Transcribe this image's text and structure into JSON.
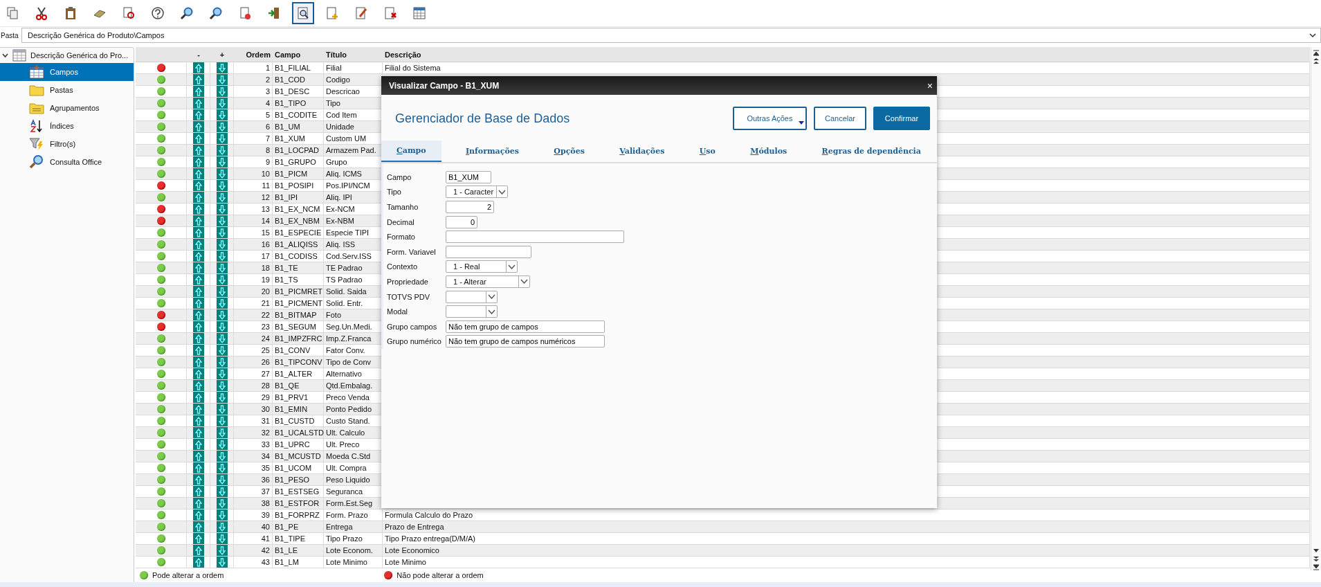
{
  "toolbar": [
    {
      "selected": false
    },
    {
      "selected": false
    },
    {
      "selected": false
    },
    {
      "selected": false
    },
    {
      "selected": false
    },
    {
      "selected": false
    },
    {
      "selected": false
    },
    {
      "selected": false
    },
    {
      "selected": false
    },
    {
      "selected": false
    },
    {
      "selected": true
    },
    {
      "selected": false
    },
    {
      "selected": false
    },
    {
      "selected": false
    },
    {
      "selected": false
    }
  ],
  "folder": {
    "label": "Pasta",
    "value": "Descrição Genérica do Produto\\Campos"
  },
  "sidebar": {
    "root": {
      "label": "Descrição Genérica do Pro...",
      "expanded": true
    },
    "items": [
      {
        "label": "Campos",
        "selected": true
      },
      {
        "label": "Pastas",
        "selected": false
      },
      {
        "label": "Agrupamentos",
        "selected": false
      },
      {
        "label": "Índices",
        "selected": false
      },
      {
        "label": "Filtro(s)",
        "selected": false
      },
      {
        "label": "Consulta Office",
        "selected": false
      }
    ]
  },
  "table": {
    "columns": [
      "-",
      "+",
      "Ordem",
      "Campo",
      "Título",
      "Descrição"
    ],
    "rows": [
      {
        "order": "1",
        "field": "B1_FILIAL",
        "title": "Filial",
        "description": "Filial do Sistema",
        "locked": true
      },
      {
        "order": "2",
        "field": "B1_COD",
        "title": "Codigo",
        "locked": false
      },
      {
        "order": "3",
        "field": "B1_DESC",
        "title": "Descricao",
        "locked": false
      },
      {
        "order": "4",
        "field": "B1_TIPO",
        "title": "Tipo",
        "locked": false
      },
      {
        "order": "5",
        "field": "B1_CODITE",
        "title": "Cod Item",
        "locked": false
      },
      {
        "order": "6",
        "field": "B1_UM",
        "title": "Unidade",
        "locked": false
      },
      {
        "order": "7",
        "field": "B1_XUM",
        "title": "Custom UM",
        "locked": false
      },
      {
        "order": "8",
        "field": "B1_LOCPAD",
        "title": "Armazem Pad.",
        "locked": false
      },
      {
        "order": "9",
        "field": "B1_GRUPO",
        "title": "Grupo",
        "locked": false
      },
      {
        "order": "10",
        "field": "B1_PICM",
        "title": "Aliq. ICMS",
        "locked": false
      },
      {
        "order": "11",
        "field": "B1_POSIPI",
        "title": "Pos.IPI/NCM",
        "locked": true
      },
      {
        "order": "12",
        "field": "B1_IPI",
        "title": "Aliq. IPI",
        "locked": false
      },
      {
        "order": "13",
        "field": "B1_EX_NCM",
        "title": "Ex-NCM",
        "locked": true
      },
      {
        "order": "14",
        "field": "B1_EX_NBM",
        "title": "Ex-NBM",
        "locked": true
      },
      {
        "order": "15",
        "field": "B1_ESPECIE",
        "title": "Especie TIPI",
        "locked": false
      },
      {
        "order": "16",
        "field": "B1_ALIQISS",
        "title": "Aliq. ISS",
        "locked": false
      },
      {
        "order": "17",
        "field": "B1_CODISS",
        "title": "Cod.Serv.ISS",
        "locked": false
      },
      {
        "order": "18",
        "field": "B1_TE",
        "title": "TE Padrao",
        "locked": false
      },
      {
        "order": "19",
        "field": "B1_TS",
        "title": "TS Padrao",
        "locked": false
      },
      {
        "order": "20",
        "field": "B1_PICMRET",
        "title": "Solid. Saida",
        "locked": false
      },
      {
        "order": "21",
        "field": "B1_PICMENT",
        "title": "Solid. Entr.",
        "locked": false
      },
      {
        "order": "22",
        "field": "B1_BITMAP",
        "title": "Foto",
        "locked": true
      },
      {
        "order": "23",
        "field": "B1_SEGUM",
        "title": "Seg.Un.Medi.",
        "locked": true
      },
      {
        "order": "24",
        "field": "B1_IMPZFRC",
        "title": "Imp.Z.Franca",
        "locked": false
      },
      {
        "order": "25",
        "field": "B1_CONV",
        "title": "Fator Conv.",
        "locked": false
      },
      {
        "order": "26",
        "field": "B1_TIPCONV",
        "title": "Tipo de Conv",
        "locked": false
      },
      {
        "order": "27",
        "field": "B1_ALTER",
        "title": "Alternativo",
        "locked": false
      },
      {
        "order": "28",
        "field": "B1_QE",
        "title": "Qtd.Embalag.",
        "locked": false
      },
      {
        "order": "29",
        "field": "B1_PRV1",
        "title": "Preco Venda",
        "locked": false
      },
      {
        "order": "30",
        "field": "B1_EMIN",
        "title": "Ponto Pedido",
        "locked": false
      },
      {
        "order": "31",
        "field": "B1_CUSTD",
        "title": "Custo Stand.",
        "locked": false
      },
      {
        "order": "32",
        "field": "B1_UCALSTD",
        "title": "Ult. Calculo",
        "locked": false
      },
      {
        "order": "33",
        "field": "B1_UPRC",
        "title": "Ult. Preco",
        "locked": false
      },
      {
        "order": "34",
        "field": "B1_MCUSTD",
        "title": "Moeda C.Std",
        "locked": false
      },
      {
        "order": "35",
        "field": "B1_UCOM",
        "title": "Ult. Compra",
        "locked": false
      },
      {
        "order": "36",
        "field": "B1_PESO",
        "title": "Peso Liquido",
        "locked": false
      },
      {
        "order": "37",
        "field": "B1_ESTSEG",
        "title": "Seguranca",
        "locked": false
      },
      {
        "order": "38",
        "field": "B1_ESTFOR",
        "title": "Form.Est.Seg",
        "locked": false
      },
      {
        "order": "39",
        "field": "B1_FORPRZ",
        "title": "Form. Prazo",
        "description": "Formula Calculo do Prazo",
        "locked": false
      },
      {
        "order": "40",
        "field": "B1_PE",
        "title": "Entrega",
        "description": "Prazo de Entrega",
        "locked": false
      },
      {
        "order": "41",
        "field": "B1_TIPE",
        "title": "Tipo Prazo",
        "description": "Tipo Prazo entrega(D/M/A)",
        "locked": false
      },
      {
        "order": "42",
        "field": "B1_LE",
        "title": "Lote Econom.",
        "description": "Lote Economico",
        "locked": false
      },
      {
        "order": "43",
        "field": "B1_LM",
        "title": "Lote Minimo",
        "description": "Lote Minimo",
        "locked": false
      }
    ]
  },
  "legend": [
    {
      "label": "Pode alterar a ordem",
      "locked": false
    },
    {
      "label": "Não pode alterar a ordem",
      "locked": true
    }
  ],
  "dialog": {
    "title": "Visualizar Campo - B1_XUM",
    "close": "×",
    "heading": "Gerenciador de Base de Dados",
    "buttons": [
      {
        "label": "Outras Ações",
        "kind": "menu"
      },
      {
        "label": "Cancelar",
        "kind": "secondary"
      },
      {
        "label": "Confirmar",
        "kind": "primary"
      }
    ],
    "tabs": [
      {
        "label": "Campo",
        "selected": true
      },
      {
        "label": "Informações",
        "selected": false
      },
      {
        "label": "Opções",
        "selected": false
      },
      {
        "label": "Validações",
        "selected": false
      },
      {
        "label": "Uso",
        "selected": false
      },
      {
        "label": "Módulos",
        "selected": false
      },
      {
        "label": "Regras de dependência",
        "selected": false
      }
    ],
    "fields": [
      {
        "label": "Campo",
        "kind": "text",
        "value": "B1_XUM"
      },
      {
        "label": "Tipo",
        "kind": "select",
        "value": "1 - Caracter"
      },
      {
        "label": "Tamanho",
        "kind": "number",
        "value": "2"
      },
      {
        "label": "Decimal",
        "kind": "number",
        "value": "0"
      },
      {
        "label": "Formato",
        "kind": "text"
      },
      {
        "label": "Form. Variavel",
        "kind": "text"
      },
      {
        "label": "Contexto",
        "kind": "select",
        "value": "1 - Real"
      },
      {
        "label": "Propriedade",
        "kind": "select",
        "value": "1 - Alterar"
      },
      {
        "label": "TOTVS PDV",
        "kind": "select"
      },
      {
        "label": "Modal",
        "kind": "select"
      },
      {
        "label": "Grupo campos",
        "kind": "text",
        "value": "Não tem grupo de campos"
      },
      {
        "label": "Grupo numérico",
        "kind": "text",
        "value": "Não tem grupo de campos numéricos"
      }
    ]
  }
}
